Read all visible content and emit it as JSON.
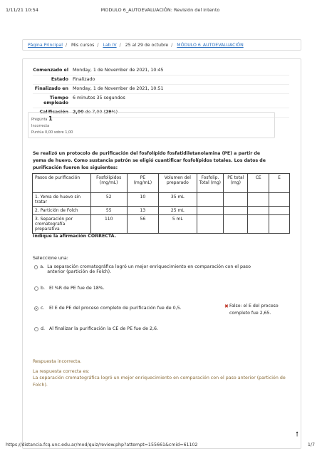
{
  "print_header": {
    "date": "1/11/21 10:54",
    "title": "MODULO 6_AUTOEVALUACIÓN: Revisión del intento"
  },
  "breadcrumb": [
    "Página Principal",
    "Mis cursos",
    "Lab IV",
    "25 al 29 de octubre",
    "MÓDULO 6_AUTOEVALUACIÓN"
  ],
  "summary": [
    {
      "label": "Comenzado el",
      "value": "Monday, 1 de November de 2021, 10:45"
    },
    {
      "label": "Estado",
      "value": "Finalizado"
    },
    {
      "label": "Finalizado en",
      "value": "Monday, 1 de November de 2021, 10:51"
    },
    {
      "label": "Tiempo empleado",
      "value": "6 minutos 35 segundos"
    },
    {
      "label": "Calificación",
      "value_bold": "2,00",
      "value_mid": " de 7,00 (",
      "value_pct": "29",
      "value_end": "%)"
    }
  ],
  "question_info": {
    "prefix": "Pregunta",
    "number": "1",
    "status": "Incorrecta",
    "score": "Puntúa 0,00 sobre 1,00"
  },
  "question_text": "Se realizó un protocolo de purificación del fosfolípido fosfatidiletanolamina (PE) a partir de yema de huevo. Como sustancia patrón se eligió cuantificar fosfolípidos totales. Los datos de purificación fueron los siguientes:",
  "table": {
    "headers": [
      "Pasos de purificación",
      "Fosfolípidos\n(mg/mL)",
      "PE\n(mg/mL)",
      "Volumen del\npreparado",
      "Fosfolip.\nTotal (mg)",
      "PE total\n(mg)",
      "CE",
      "E"
    ],
    "rows": [
      [
        "1. Yema de huevo sin tratar",
        "52",
        "10",
        "35 mL",
        "",
        "",
        "",
        ""
      ],
      [
        "2. Partición de Folch",
        "55",
        "13",
        "25 mL",
        "",
        "",
        "",
        ""
      ],
      [
        "3. Separación por cromatografía preparativa",
        "110",
        "56",
        "5  mL",
        "",
        "",
        "",
        ""
      ]
    ]
  },
  "instruction": "Indique la afirmación CORRECTA.",
  "select_label": "Seleccione una:",
  "options": [
    {
      "letter": "a.",
      "text": "La separación cromatográfica logró un mejor enriquecimiento en comparación con el paso anterior (partición de Folch).",
      "checked": false
    },
    {
      "letter": "b.",
      "text": "El %R de PE fue de 18%.",
      "checked": false
    },
    {
      "letter": "c.",
      "text": "El E de PE del proceso completo de purificación fue de 0,5.",
      "checked": true
    },
    {
      "letter": "d.",
      "text": "Al finalizar la purificación la CE de PE fue de 2,6.",
      "checked": false
    }
  ],
  "feedback": {
    "icon": "✖",
    "text": "Falso: el E del proceso completo fue 2,65."
  },
  "outcome": {
    "line1": "Respuesta incorrecta.",
    "line2": "La respuesta correcta es:",
    "line3": "La separación cromatográfica logró un mejor enriquecimiento en comparación con el paso anterior (partición de Folch)."
  },
  "print_footer": {
    "url": "https://distancia.fcq.unc.edu.ar/mod/quiz/review.php?attempt=155661&cmid=61102",
    "page": "1/7"
  },
  "scroll_top_icon": "arrow-up-icon"
}
